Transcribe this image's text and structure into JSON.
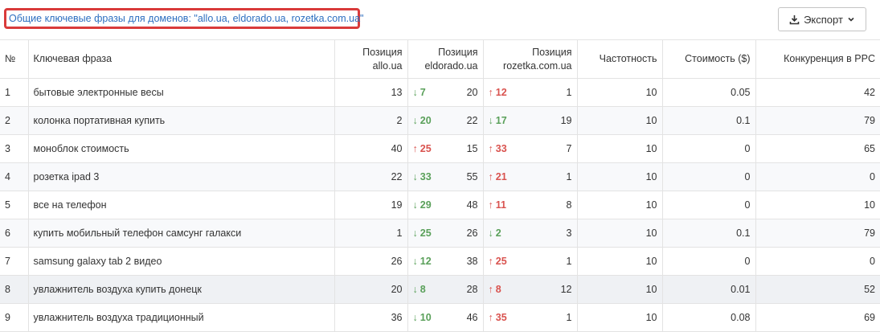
{
  "header": {
    "title": "Общие ключевые фразы для доменов: \"allo.ua, eldorado.ua, rozetka.com.ua\"",
    "export_label": "Экспорт"
  },
  "columns": {
    "num": "№",
    "phrase": "Ключевая фраза",
    "pos1_line1": "Позиция",
    "pos1_line2": "allo.ua",
    "pos2_line1": "Позиция",
    "pos2_line2": "eldorado.ua",
    "pos3_line1": "Позиция",
    "pos3_line2": "rozetka.com.ua",
    "freq": "Частотность",
    "cost": "Стоимость ($)",
    "comp": "Конкуренция в PPC"
  },
  "colors": {
    "down": "#5aa05a",
    "up": "#d9534f",
    "title": "#2d6fc0",
    "highlight_border": "#d93b3b"
  },
  "rows": [
    {
      "num": "1",
      "phrase": "бытовые электронные весы",
      "pos1": "13",
      "d2": "down",
      "c2": "7",
      "pos2": "20",
      "d3": "up",
      "c3": "12",
      "pos3": "1",
      "freq": "10",
      "cost": "0.05",
      "comp": "42"
    },
    {
      "num": "2",
      "phrase": "колонка портативная купить",
      "pos1": "2",
      "d2": "down",
      "c2": "20",
      "pos2": "22",
      "d3": "down",
      "c3": "17",
      "pos3": "19",
      "freq": "10",
      "cost": "0.1",
      "comp": "79"
    },
    {
      "num": "3",
      "phrase": "моноблок стоимость",
      "pos1": "40",
      "d2": "up",
      "c2": "25",
      "pos2": "15",
      "d3": "up",
      "c3": "33",
      "pos3": "7",
      "freq": "10",
      "cost": "0",
      "comp": "65"
    },
    {
      "num": "4",
      "phrase": "розетка ipad 3",
      "pos1": "22",
      "d2": "down",
      "c2": "33",
      "pos2": "55",
      "d3": "up",
      "c3": "21",
      "pos3": "1",
      "freq": "10",
      "cost": "0",
      "comp": "0"
    },
    {
      "num": "5",
      "phrase": "все на телефон",
      "pos1": "19",
      "d2": "down",
      "c2": "29",
      "pos2": "48",
      "d3": "up",
      "c3": "11",
      "pos3": "8",
      "freq": "10",
      "cost": "0",
      "comp": "10"
    },
    {
      "num": "6",
      "phrase": "купить мобильный телефон самсунг галакси",
      "pos1": "1",
      "d2": "down",
      "c2": "25",
      "pos2": "26",
      "d3": "down",
      "c3": "2",
      "pos3": "3",
      "freq": "10",
      "cost": "0.1",
      "comp": "79"
    },
    {
      "num": "7",
      "phrase": "samsung galaxy tab 2 видео",
      "pos1": "26",
      "d2": "down",
      "c2": "12",
      "pos2": "38",
      "d3": "up",
      "c3": "25",
      "pos3": "1",
      "freq": "10",
      "cost": "0",
      "comp": "0"
    },
    {
      "num": "8",
      "phrase": "увлажнитель воздуха купить донецк",
      "pos1": "20",
      "d2": "down",
      "c2": "8",
      "pos2": "28",
      "d3": "up",
      "c3": "8",
      "pos3": "12",
      "freq": "10",
      "cost": "0.01",
      "comp": "52"
    },
    {
      "num": "9",
      "phrase": "увлажнитель воздуха традиционный",
      "pos1": "36",
      "d2": "down",
      "c2": "10",
      "pos2": "46",
      "d3": "up",
      "c3": "35",
      "pos3": "1",
      "freq": "10",
      "cost": "0.08",
      "comp": "69"
    }
  ]
}
